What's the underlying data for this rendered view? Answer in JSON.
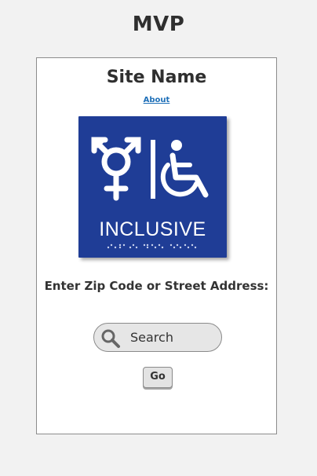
{
  "page": {
    "heading": "MVP"
  },
  "site": {
    "name": "Site Name",
    "about_link": "About"
  },
  "sign": {
    "text": "INCLUSIVE",
    "background_color": "#1f3d96",
    "icons": [
      "all-gender-symbol-icon",
      "wheelchair-accessible-icon"
    ]
  },
  "search": {
    "prompt": "Enter Zip Code or Street Address:",
    "placeholder": "Search",
    "go_label": "Go"
  },
  "colors": {
    "link": "#1e6fb8",
    "page_background": "#f2f2f2"
  }
}
